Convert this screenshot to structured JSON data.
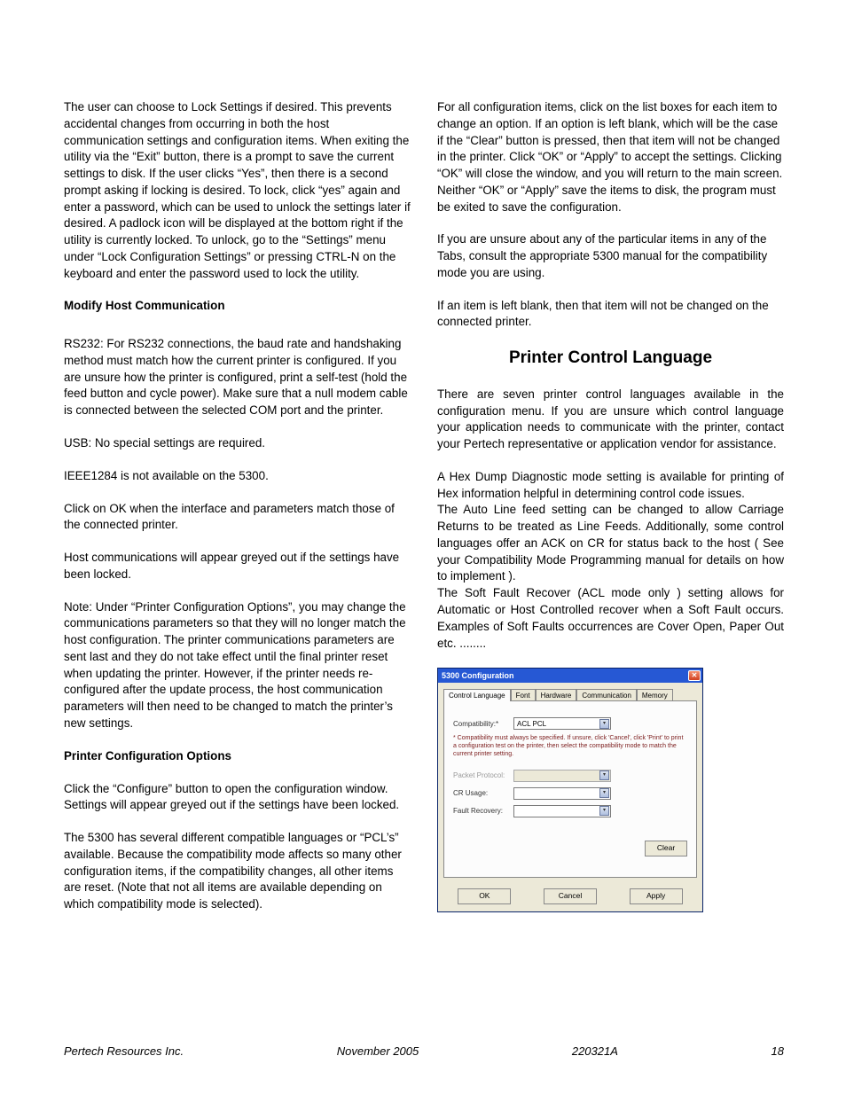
{
  "left": {
    "p1": "The user can choose to Lock Settings if desired.  This prevents accidental changes from occurring in both the host communication settings and configuration items. When exiting the utility via the “Exit” button, there is a prompt to save the current settings to disk.  If the user clicks “Yes”, then there is a second prompt asking if locking is desired.  To lock, click “yes” again and enter a password, which can be used to unlock the settings later if desired.  A padlock icon will be displayed at the bottom right if the utility is currently locked.  To unlock, go to the “Settings” menu under “Lock Configuration Settings” or pressing CTRL-N on the keyboard and enter the password used to lock the utility.",
    "h1": "Modify Host Communication",
    "p2": "RS232: For RS232 connections, the baud rate and handshaking method must match how the current printer is configured.  If you are unsure how the printer is configured, print a self-test (hold the feed button and cycle power).  Make sure that a null modem cable is connected between the selected COM port and the printer.",
    "p3": "USB:  No special settings are required.",
    "p4": "IEEE1284 is not available on the 5300.",
    "p5": "Click on OK when the interface and parameters match those of the connected printer.",
    "p6": "Host communications will appear greyed out if the settings have been locked.",
    "p7": "Note: Under “Printer Configuration Options”, you may change the communications parameters so that they will no longer match the host configuration.  The printer communications parameters are sent last and they do not take effect until the final printer reset when updating the printer.  However, if the printer needs re-configured after the update process, the host communication parameters will then need to be changed to match the printer’s new settings.",
    "h2": "Printer Configuration Options",
    "p8": "Click the “Configure” button to open the configuration window.  Settings will appear greyed out if the settings have been locked.",
    "p9": "The 5300 has several different compatible languages or “PCL’s” available.  Because the compatibility mode affects so many other configuration items, if the compatibility changes, all other items are reset.  (Note that not all items are available depending on which compatibility mode is selected)."
  },
  "right": {
    "p1": "For all configuration items, click on the list boxes for each item to change an option.  If an option is left blank, which will be the case if the “Clear” button is pressed, then that item will not be changed in the printer.  Click “OK” or “Apply” to accept the settings.  Clicking “OK” will close the window, and you will return to the main screen.  Neither “OK” or “Apply” save the items to disk, the program must be exited to save the configuration.",
    "p2": "If you are unsure about any of the particular items in any of the Tabs, consult the appropriate 5300 manual for the compatibility mode you are using.",
    "p3": "If an item is left blank, then that item will not be changed on the connected printer.",
    "title": "Printer Control Language",
    "p4": "There are seven  printer control languages available in the configuration menu. If you are unsure which control language your application needs to communicate with the printer, contact your Pertech representative or application vendor for assistance.",
    "p5": " A Hex Dump Diagnostic mode setting is available for printing of Hex information helpful in determining control code issues.",
    "p6": "The Auto Line feed setting can be changed to allow Carriage Returns to be treated as Line Feeds. Additionally, some control languages offer an ACK on CR for status back to the host  ( See your Compatibility Mode Programming manual for details on how to implement ).",
    "p7": "The Soft Fault Recover (ACL mode only ) setting allows for Automatic or Host Controlled recover when a Soft Fault occurs. Examples of  Soft Faults occurrences are Cover Open, Paper Out etc. ........"
  },
  "dialog": {
    "title": "5300 Configuration",
    "close_glyph": "✕",
    "tabs": [
      "Control Language",
      "Font",
      "Hardware",
      "Communication",
      "Memory"
    ],
    "compat_label": "Compatibility:*",
    "compat_value": "ACL PCL",
    "hint": "* Compatibility must always be specified. If unsure, click 'Cancel', click 'Print' to print a configuration test on the printer, then select the compatibility mode to match the current printer setting.",
    "packet_label": "Packet Protocol:",
    "cr_label": "CR Usage:",
    "fault_label": "Fault Recovery:",
    "clear": "Clear",
    "ok": "OK",
    "cancel": "Cancel",
    "apply": "Apply",
    "dd_glyph": "▾"
  },
  "footer": {
    "company": "Pertech Resources Inc.",
    "date": "November  2005",
    "docnum": "220321A",
    "page": "18"
  }
}
